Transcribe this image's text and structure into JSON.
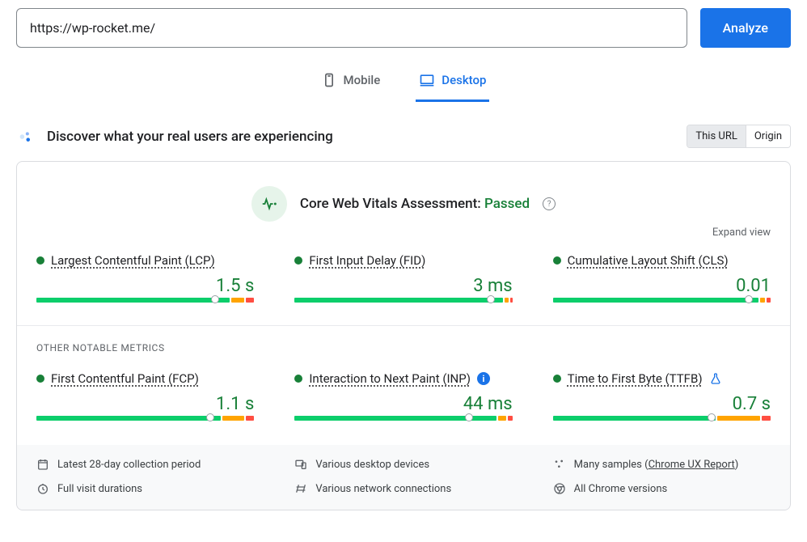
{
  "input": {
    "value": "https://wp-rocket.me/"
  },
  "buttons": {
    "analyze": "Analyze"
  },
  "tabs": {
    "mobile": "Mobile",
    "desktop": "Desktop"
  },
  "header": {
    "title": "Discover what your real users are experiencing",
    "toggle": {
      "this_url": "This URL",
      "origin": "Origin"
    }
  },
  "assessment": {
    "label": "Core Web Vitals Assessment: ",
    "status": "Passed"
  },
  "expand": "Expand view",
  "metrics": {
    "lcp": {
      "name": "Largest Contentful Paint (LCP)",
      "value": "1.5 s"
    },
    "fid": {
      "name": "First Input Delay (FID)",
      "value": "3 ms"
    },
    "cls": {
      "name": "Cumulative Layout Shift (CLS)",
      "value": "0.01"
    },
    "fcp": {
      "name": "First Contentful Paint (FCP)",
      "value": "1.1 s"
    },
    "inp": {
      "name": "Interaction to Next Paint (INP)",
      "value": "44 ms"
    },
    "ttfb": {
      "name": "Time to First Byte (TTFB)",
      "value": "0.7 s"
    }
  },
  "other_label": "Other Notable Metrics",
  "footer": {
    "period": "Latest 28-day collection period",
    "devices": "Various desktop devices",
    "samples_prefix": "Many samples (",
    "samples_link": "Chrome UX Report",
    "samples_suffix": ")",
    "durations": "Full visit durations",
    "network": "Various network connections",
    "chrome": "All Chrome versions"
  },
  "chart_data": [
    {
      "id": "lcp",
      "distribution": {
        "good": 90,
        "needs_improvement": 6,
        "poor": 4
      },
      "marker_pct": 82
    },
    {
      "id": "fid",
      "distribution": {
        "good": 97,
        "needs_improvement": 2,
        "poor": 1
      },
      "marker_pct": 90
    },
    {
      "id": "cls",
      "distribution": {
        "good": 96,
        "needs_improvement": 2,
        "poor": 2
      },
      "marker_pct": 90
    },
    {
      "id": "fcp",
      "distribution": {
        "good": 86,
        "needs_improvement": 10,
        "poor": 4
      },
      "marker_pct": 80
    },
    {
      "id": "inp",
      "distribution": {
        "good": 94,
        "needs_improvement": 4,
        "poor": 2
      },
      "marker_pct": 80
    },
    {
      "id": "ttfb",
      "distribution": {
        "good": 76,
        "needs_improvement": 20,
        "poor": 4
      },
      "marker_pct": 73
    }
  ]
}
